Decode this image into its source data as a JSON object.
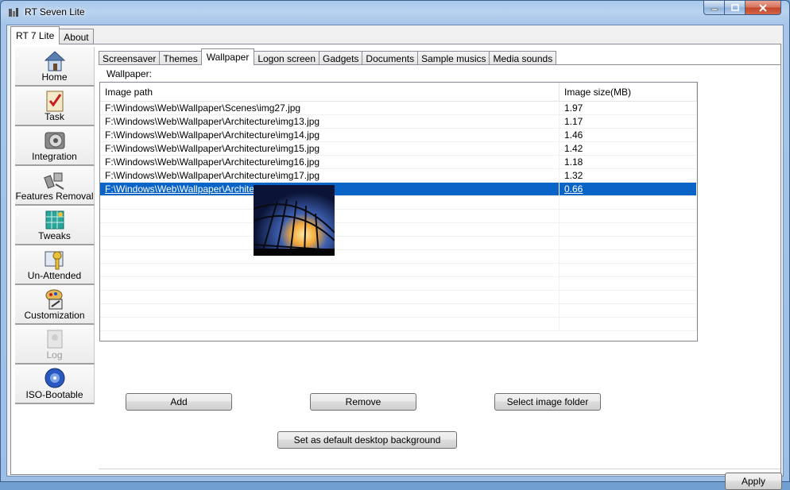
{
  "window": {
    "title": "RT Seven Lite"
  },
  "outer_tabs": [
    {
      "label": "RT 7 Lite",
      "active": true
    },
    {
      "label": "About",
      "active": false
    }
  ],
  "sidebar": {
    "items": [
      {
        "label": "Home",
        "icon": "home-icon",
        "disabled": false
      },
      {
        "label": "Task",
        "icon": "task-checklist-icon",
        "disabled": false
      },
      {
        "label": "Integration",
        "icon": "integration-disc-icon",
        "disabled": false
      },
      {
        "label": "Features Removal",
        "icon": "features-removal-icon",
        "disabled": false
      },
      {
        "label": "Tweaks",
        "icon": "tweaks-grid-icon",
        "disabled": false
      },
      {
        "label": "Un-Attended",
        "icon": "unattended-key-icon",
        "disabled": false
      },
      {
        "label": "Customization",
        "icon": "customization-palette-icon",
        "disabled": false
      },
      {
        "label": "Log",
        "icon": "log-icon",
        "disabled": true
      },
      {
        "label": "ISO-Bootable",
        "icon": "iso-disc-icon",
        "disabled": false
      }
    ]
  },
  "inner_tabs": [
    {
      "label": "Screensaver",
      "active": false
    },
    {
      "label": "Themes",
      "active": false
    },
    {
      "label": "Wallpaper",
      "active": true
    },
    {
      "label": "Logon screen",
      "active": false
    },
    {
      "label": "Gadgets",
      "active": false
    },
    {
      "label": "Documents",
      "active": false
    },
    {
      "label": "Sample musics",
      "active": false
    },
    {
      "label": "Media sounds",
      "active": false
    }
  ],
  "wallpaper": {
    "group_label": "Wallpaper:",
    "columns": [
      "Image path",
      "Image size(MB)"
    ],
    "rows": [
      {
        "path": "F:\\Windows\\Web\\Wallpaper\\Scenes\\img27.jpg",
        "size": "1.97"
      },
      {
        "path": "F:\\Windows\\Web\\Wallpaper\\Architecture\\img13.jpg",
        "size": "1.17"
      },
      {
        "path": "F:\\Windows\\Web\\Wallpaper\\Architecture\\img14.jpg",
        "size": "1.46"
      },
      {
        "path": "F:\\Windows\\Web\\Wallpaper\\Architecture\\img15.jpg",
        "size": "1.42"
      },
      {
        "path": "F:\\Windows\\Web\\Wallpaper\\Architecture\\img16.jpg",
        "size": "1.18"
      },
      {
        "path": "F:\\Windows\\Web\\Wallpaper\\Architecture\\img17.jpg",
        "size": "1.32"
      },
      {
        "path": "F:\\Windows\\Web\\Wallpaper\\Architecture\\img18.jpg",
        "size": "0.66"
      }
    ],
    "selected_index": 6,
    "empty_rows": 10,
    "buttons": {
      "add": "Add",
      "remove": "Remove",
      "select_folder": "Select image folder",
      "set_default": "Set as default desktop background"
    }
  },
  "footer": {
    "apply": "Apply"
  },
  "colors": {
    "selection": "#0a64c8",
    "titlebar": "#a9c9ec"
  }
}
